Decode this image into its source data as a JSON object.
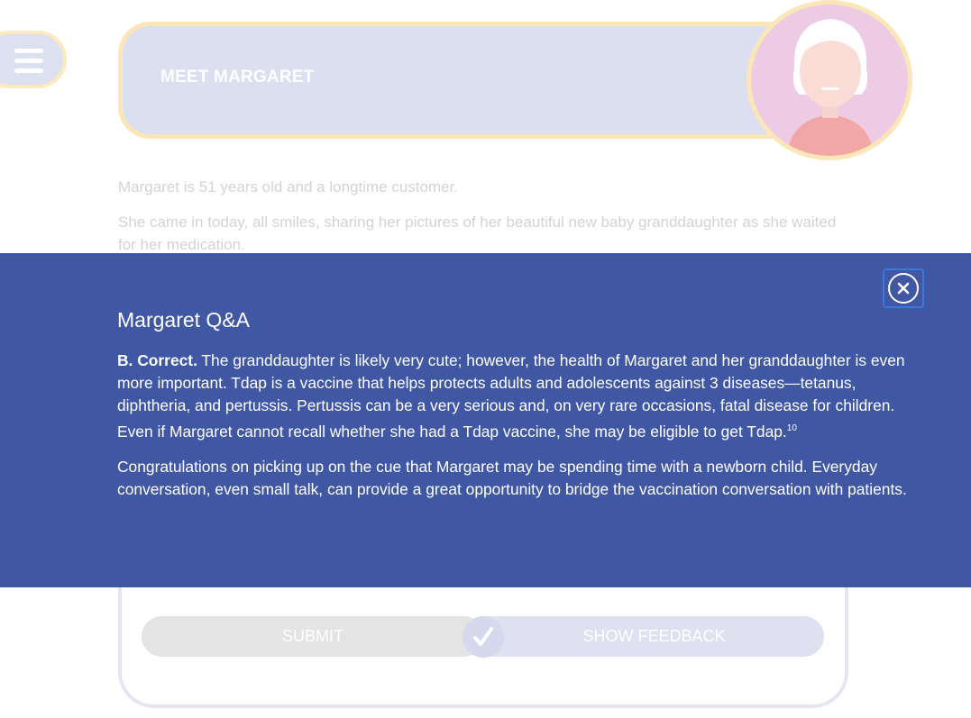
{
  "header": {
    "title": "MEET MARGARET"
  },
  "intro": {
    "p1": "Margaret is 51 years old and a longtime customer.",
    "p2": "She came in today, all smiles, sharing her pictures of her beautiful new baby granddaughter as she waited for her medication."
  },
  "modal": {
    "title": "Margaret Q&A",
    "answer_label": "B. Correct.",
    "answer_text": " The granddaughter is likely very cute; however, the health of Margaret and her granddaughter is even more important. Tdap is a vaccine that helps protects adults and adolescents against 3 diseases—tetanus, diphtheria, and pertussis. Pertussis can be a very serious and, on very rare occasions, fatal disease for children. Even if Margaret cannot recall whether she had a Tdap vaccine, she may be eligible to get Tdap.",
    "footnote": "10",
    "congrats": "Congratulations on picking up on the cue that Margaret may be spending time with a newborn child. Everyday conversation, even small talk, can provide a great opportunity to bridge the vaccination conversation with patients.",
    "close_icon": "close-icon"
  },
  "quiz": {
    "submit_label": "SUBMIT",
    "feedback_label": "SHOW FEEDBACK"
  },
  "colors": {
    "modal_bg": "#4057a4",
    "header_bg": "#dcdff0",
    "accent_border": "#fbe6b8"
  }
}
